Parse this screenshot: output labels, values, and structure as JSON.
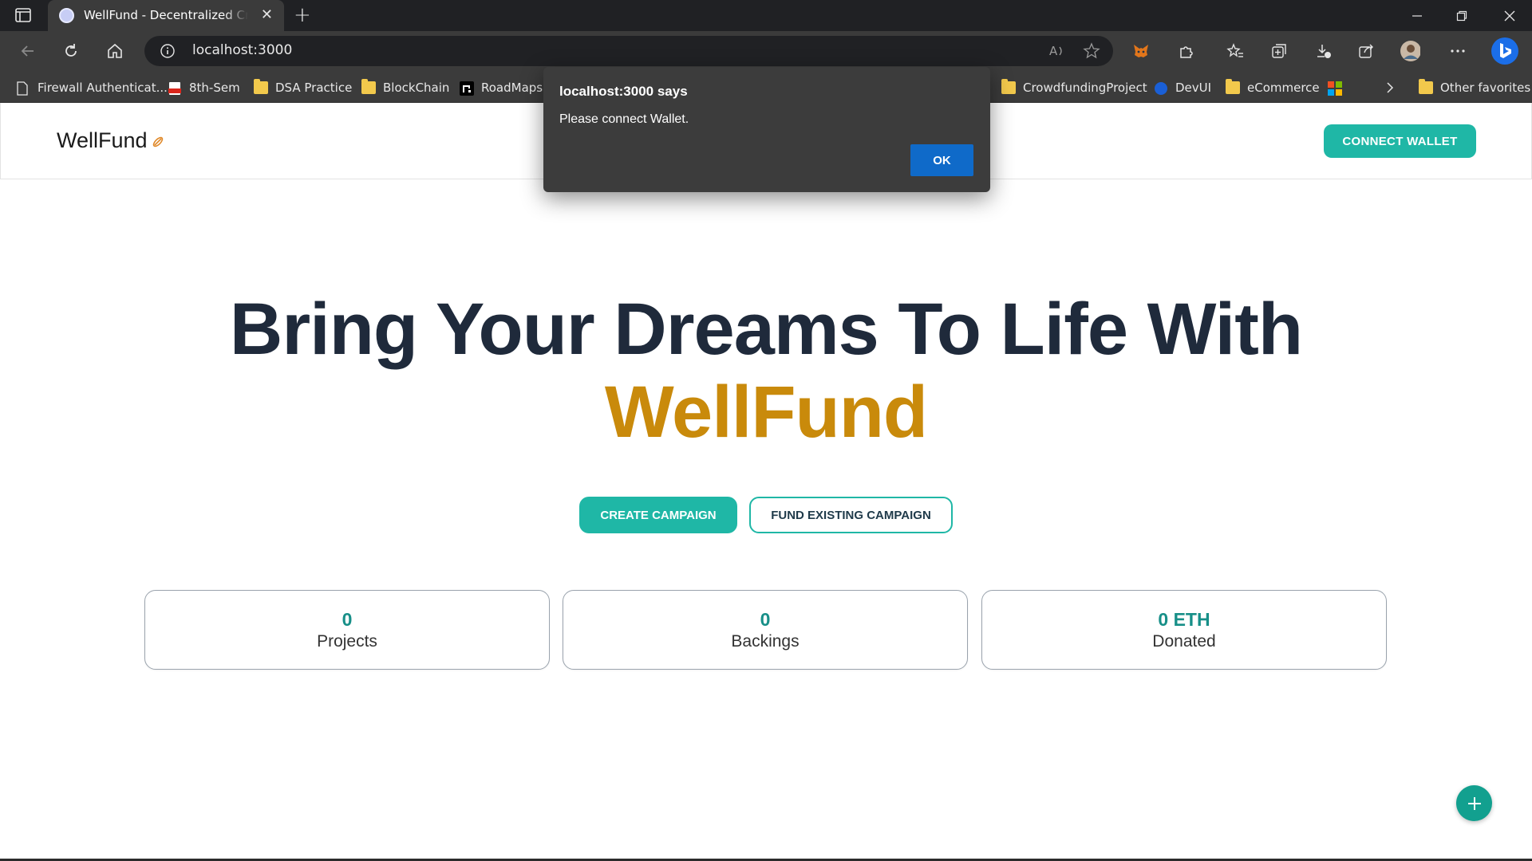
{
  "browser": {
    "tab": {
      "title": "WellFund - Decentralized Crowdfunding",
      "close_glyph": "✕"
    },
    "new_tab_glyph": "+",
    "address": "localhost:3000",
    "bookmarks": [
      {
        "label": "Firewall Authenticat...",
        "icon": "page-icon"
      },
      {
        "label": "8th-Sem",
        "icon": "pdf-icon"
      },
      {
        "label": "DSA Practice",
        "icon": "folder-icon"
      },
      {
        "label": "BlockChain",
        "icon": "folder-icon"
      },
      {
        "label": "RoadMaps",
        "icon": "roadmap-icon"
      },
      {
        "label": "CrowdfundingProject",
        "icon": "folder-icon"
      },
      {
        "label": "DevUI",
        "icon": "globe-icon"
      },
      {
        "label": "eCommerce",
        "icon": "folder-icon"
      },
      {
        "label": "",
        "icon": "microsoft-icon"
      },
      {
        "label": "Other favorites",
        "icon": "folder-icon"
      }
    ]
  },
  "navbar": {
    "brand": "WellFund",
    "brand_icon": "link-icon",
    "connect_label": "CONNECT WALLET"
  },
  "hero": {
    "line1": "Bring Your Dreams To Life With",
    "line2": "WellFund"
  },
  "actions": {
    "create_label": "CREATE CAMPAIGN",
    "fund_label": "FUND EXISTING CAMPAIGN"
  },
  "stats": [
    {
      "value": "0",
      "label": "Projects"
    },
    {
      "value": "0",
      "label": "Backings"
    },
    {
      "value": "0 ETH",
      "label": "Donated"
    }
  ],
  "dialog": {
    "title": "localhost:3000 says",
    "message": "Please connect Wallet.",
    "ok_label": "OK"
  },
  "colors": {
    "accent": "#1fb7a6",
    "brand_gold": "#c98a0b",
    "heading": "#1f2a3b",
    "stat_value": "#178f88",
    "dialog_bg": "#3c3c3c",
    "dialog_ok": "#0f6ac9"
  }
}
